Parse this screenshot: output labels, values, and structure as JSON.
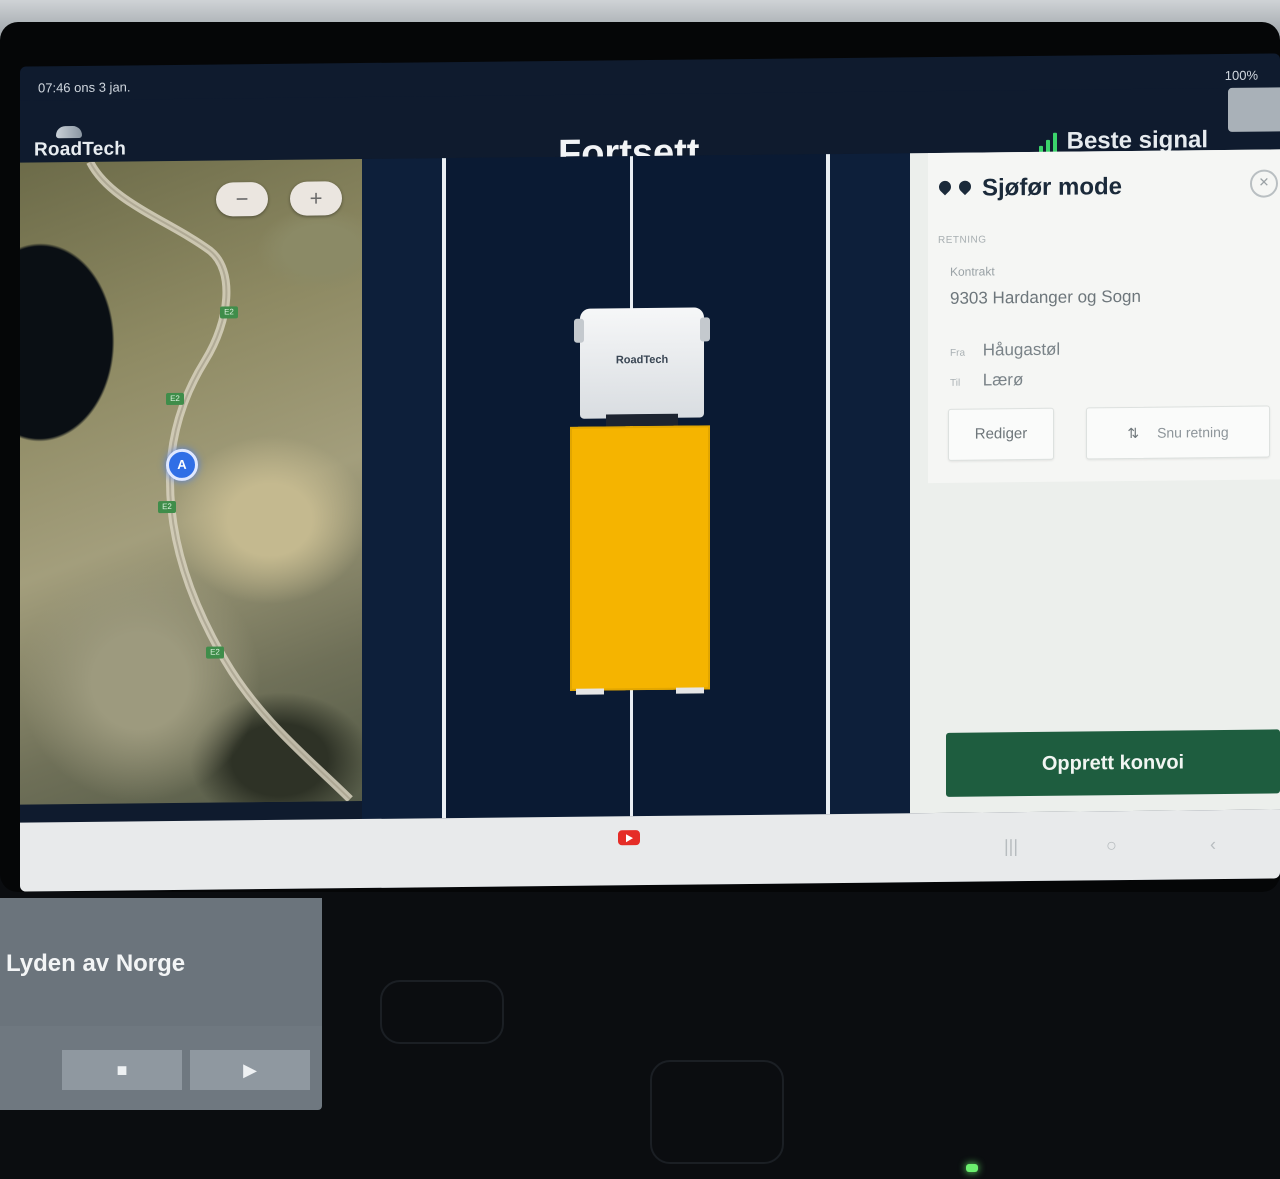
{
  "status_bar": {
    "left_text": "07:46 ons 3 jan.",
    "right_text": "100%"
  },
  "app": {
    "logo": "RoadTech",
    "title": "Fortsett",
    "signal_label": "Beste signal",
    "signal_color": "#3bd36b"
  },
  "map": {
    "zoom_out_label": "−",
    "zoom_in_label": "+",
    "road_labels": [
      "E2",
      "E2",
      "E2",
      "E2"
    ],
    "position_marker_label": "A"
  },
  "lane_view": {
    "truck_cab_logo": "RoadTech",
    "trailer_color": "#f5b400"
  },
  "side_panel": {
    "title": "Sjøfør mode",
    "section_label": "RETNING",
    "contract_label": "Kontrakt",
    "contract_value": "9303 Hardanger og Sogn",
    "from_tag": "Fra",
    "from_value": "Håugastøl",
    "to_tag": "Til",
    "to_value": "Lærø",
    "edit_button": "Rediger",
    "swap_button": "Snu retning",
    "create_button": "Opprett konvoi",
    "create_button_color": "#1e5d3f"
  },
  "car_radio": {
    "station_text": "Lyden av Norge",
    "stop_label": "■",
    "play_label": "▶"
  }
}
